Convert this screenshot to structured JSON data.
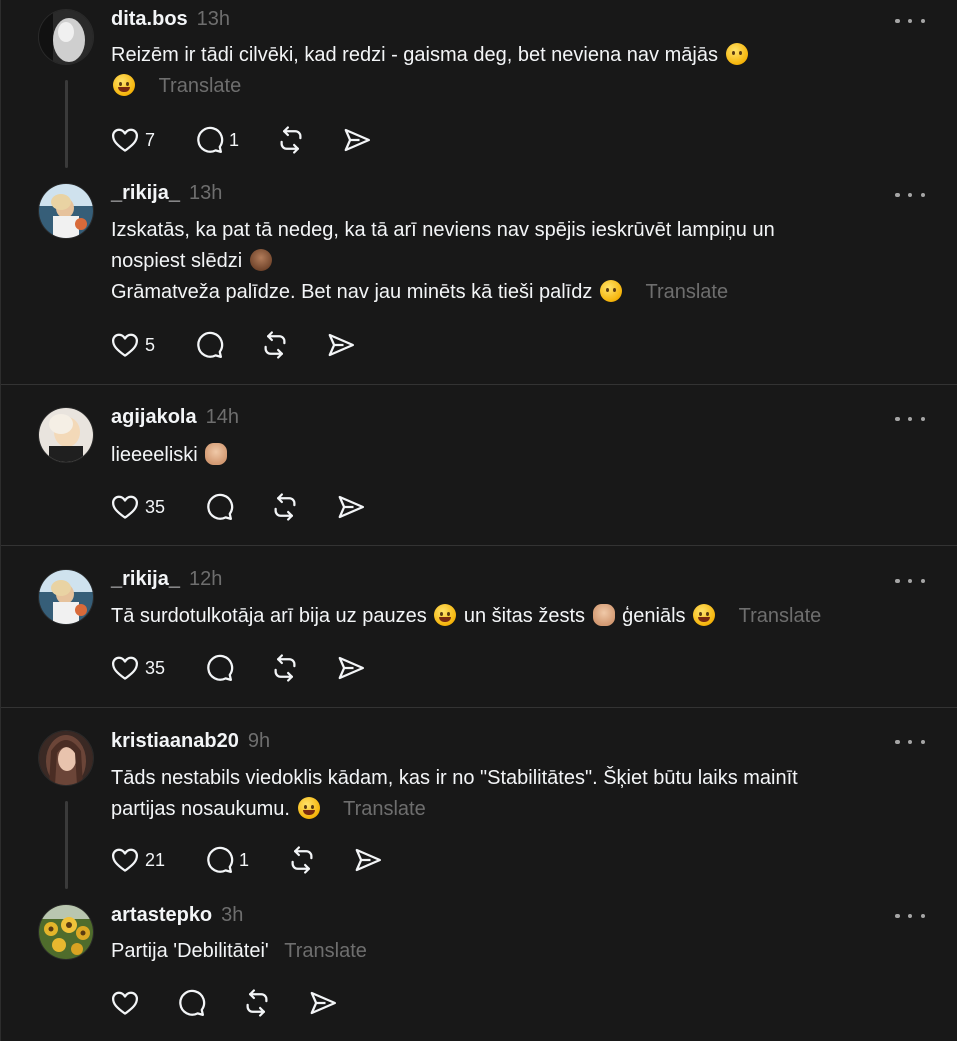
{
  "posts": [
    {
      "username": "dita.bos",
      "time": "13h",
      "lines": [
        "Reizēm ir tādi cilvēki, kad redzi - gaisma deg, bet neviena nav mājās"
      ],
      "translate": "Translate",
      "likes": "7",
      "replies": "1",
      "avatar_colors": [
        "#d8d8d8",
        "#1b1b1b"
      ]
    },
    {
      "username": "_rikija_",
      "time": "13h",
      "lines": [
        "Izskatās, ka pat tā nedeg, ka tā arī neviens nav spējis ieskrūvēt lampiņu un",
        "nospiest slēdzi",
        "Grāmatveža palīdze. Bet nav jau minēts kā tieši palīdz"
      ],
      "translate": "Translate",
      "likes": "5",
      "replies": "",
      "avatar_colors": [
        "#e8c79a",
        "#3b6d8c"
      ]
    },
    {
      "username": "agijakola",
      "time": "14h",
      "lines": [
        "lieeeeliski"
      ],
      "translate": "",
      "likes": "35",
      "replies": "",
      "avatar_colors": [
        "#f0ddc8",
        "#5a3b2b"
      ]
    },
    {
      "username": "_rikija_",
      "time": "12h",
      "lines": [
        "Tā surdotulkotāja arī bija uz pauzes",
        "un šitas žests",
        "ģeniāls"
      ],
      "translate": "Translate",
      "likes": "35",
      "replies": "",
      "avatar_colors": [
        "#e8c79a",
        "#3b6d8c"
      ]
    },
    {
      "username": "kristiaanab20",
      "time": "9h",
      "lines": [
        "Tāds nestabils viedoklis kādam, kas ir no \"Stabilitātes\". Šķiet būtu laiks mainīt",
        "partijas nosaukumu."
      ],
      "translate": "Translate",
      "likes": "21",
      "replies": "1",
      "avatar_colors": [
        "#7d5a4d",
        "#2a1c18"
      ]
    },
    {
      "username": "artastepko",
      "time": "3h",
      "lines": [
        "Partija 'Debilitātei'"
      ],
      "translate": "Translate",
      "likes": "",
      "replies": "",
      "avatar_colors": [
        "#e3b32a",
        "#4d6b2a"
      ]
    }
  ],
  "icons": {
    "like": "heart-icon",
    "reply": "comment-bubble-icon",
    "repost": "repost-arrows-icon",
    "share": "send-paper-plane-icon",
    "more": "more-dots-icon"
  },
  "colors": {
    "background": "#181818",
    "text": "#f3f5f7",
    "muted": "#6e6e6e",
    "divider": "#333333"
  }
}
